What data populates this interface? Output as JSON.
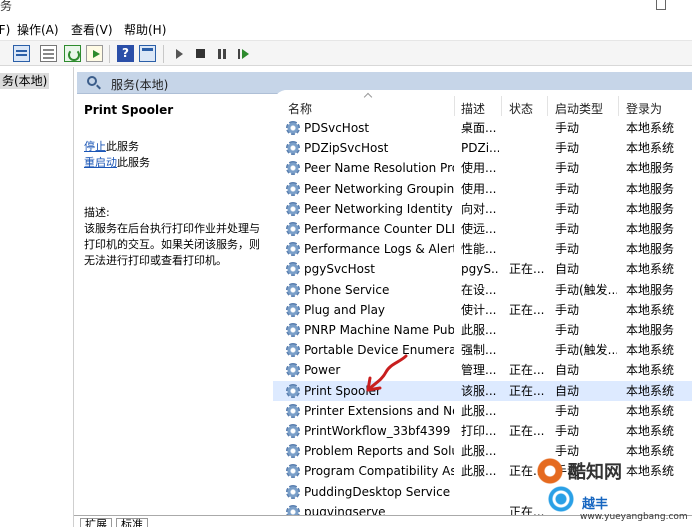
{
  "window": {
    "title_fragment": "务"
  },
  "menu": [
    {
      "label": "文件(F)",
      "visible": "件(F)"
    },
    {
      "label": "操作(A)"
    },
    {
      "label": "查看(V)"
    },
    {
      "label": "帮助(H)"
    }
  ],
  "tree": {
    "selected": "务(本地)"
  },
  "pane_header": "服务(本地)",
  "description": {
    "service_name": "Print Spooler",
    "stop_link": "停止",
    "stop_suffix": "此服务",
    "restart_link": "重启动",
    "restart_suffix": "此服务",
    "label": "描述:",
    "lines": [
      "该服务在后台执行打印作业并处理与",
      "打印机的交互。如果关闭该服务，则",
      "无法进行打印或查看打印机。"
    ]
  },
  "columns": {
    "name": "名称",
    "desc": "描述",
    "status": "状态",
    "startup": "启动类型",
    "logon": "登录为"
  },
  "rows": [
    {
      "name": "PDSvcHost",
      "desc": "桌面...",
      "status": "",
      "startup": "手动",
      "logon": "本地系统"
    },
    {
      "name": "PDZipSvcHost",
      "desc": "PDZi...",
      "status": "",
      "startup": "手动",
      "logon": "本地系统"
    },
    {
      "name": "Peer Name Resolution Pro...",
      "desc": "使用...",
      "status": "",
      "startup": "手动",
      "logon": "本地服务"
    },
    {
      "name": "Peer Networking Grouping",
      "desc": "使用...",
      "status": "",
      "startup": "手动",
      "logon": "本地服务"
    },
    {
      "name": "Peer Networking Identity ...",
      "desc": "向对...",
      "status": "",
      "startup": "手动",
      "logon": "本地服务"
    },
    {
      "name": "Performance Counter DLL ...",
      "desc": "使远...",
      "status": "",
      "startup": "手动",
      "logon": "本地服务"
    },
    {
      "name": "Performance Logs & Alerts",
      "desc": "性能...",
      "status": "",
      "startup": "手动",
      "logon": "本地服务"
    },
    {
      "name": "pgySvcHost",
      "desc": "pgyS...",
      "status": "正在...",
      "startup": "自动",
      "logon": "本地系统"
    },
    {
      "name": "Phone Service",
      "desc": "在设...",
      "status": "",
      "startup": "手动(触发...",
      "logon": "本地服务"
    },
    {
      "name": "Plug and Play",
      "desc": "使计...",
      "status": "正在...",
      "startup": "手动",
      "logon": "本地系统"
    },
    {
      "name": "PNRP Machine Name Publ...",
      "desc": "此服...",
      "status": "",
      "startup": "手动",
      "logon": "本地服务"
    },
    {
      "name": "Portable Device Enumerat...",
      "desc": "强制...",
      "status": "",
      "startup": "手动(触发...",
      "logon": "本地系统"
    },
    {
      "name": "Power",
      "desc": "管理...",
      "status": "正在...",
      "startup": "自动",
      "logon": "本地系统"
    },
    {
      "name": "Print Spooler",
      "desc": "该服...",
      "status": "正在...",
      "startup": "自动",
      "logon": "本地系统",
      "selected": true
    },
    {
      "name": "Printer Extensions and Noti...",
      "desc": "此服...",
      "status": "",
      "startup": "手动",
      "logon": "本地系统"
    },
    {
      "name": "PrintWorkflow_33bf4399",
      "desc": "打印...",
      "status": "正在...",
      "startup": "手动",
      "logon": "本地系统"
    },
    {
      "name": "Problem Reports and Solut...",
      "desc": "此服...",
      "status": "",
      "startup": "手动",
      "logon": "本地系统"
    },
    {
      "name": "Program Compatibility Assi...",
      "desc": "此服...",
      "status": "正在...",
      "startup": "手动",
      "logon": "本地系统"
    },
    {
      "name": "PuddingDesktop Service",
      "desc": "",
      "status": "",
      "startup": "",
      "logon": ""
    },
    {
      "name": "pugvingserve",
      "desc": "",
      "status": "正在...",
      "startup": "",
      "logon": ""
    }
  ],
  "bottom_tabs": [
    "扩展",
    "标准"
  ],
  "watermark": {
    "brand": "酷知网",
    "url": "www.yueyangbang.com",
    "brand2": "越丰"
  },
  "colors": {
    "pane_header": "#c6d5e8",
    "selected_row": "#ddeaff",
    "link": "#1a55b5",
    "annotation_arrow": "#c81e1e"
  }
}
